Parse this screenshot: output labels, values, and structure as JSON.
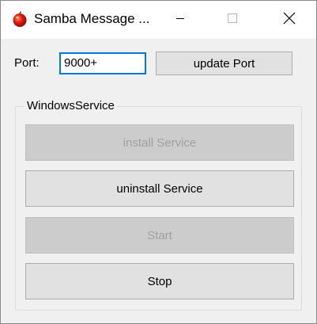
{
  "window": {
    "title": "Samba Message ...",
    "icon": "apple-icon",
    "controls": {
      "minimize": "minimize-icon",
      "maximize": "maximize-icon",
      "close": "close-icon"
    }
  },
  "port": {
    "label": "Port:",
    "value": "9000+",
    "update_button": "update Port"
  },
  "service_group": {
    "title": "WindowsService",
    "buttons": [
      {
        "label": "install Service",
        "enabled": false
      },
      {
        "label": "uninstall Service",
        "enabled": true
      },
      {
        "label": "Start",
        "enabled": false
      },
      {
        "label": "Stop",
        "enabled": true
      }
    ]
  },
  "colors": {
    "focus_border": "#0078d7",
    "button_face": "#e1e1e1",
    "disabled_face": "#cccccc",
    "disabled_text": "#a0a0a0"
  }
}
